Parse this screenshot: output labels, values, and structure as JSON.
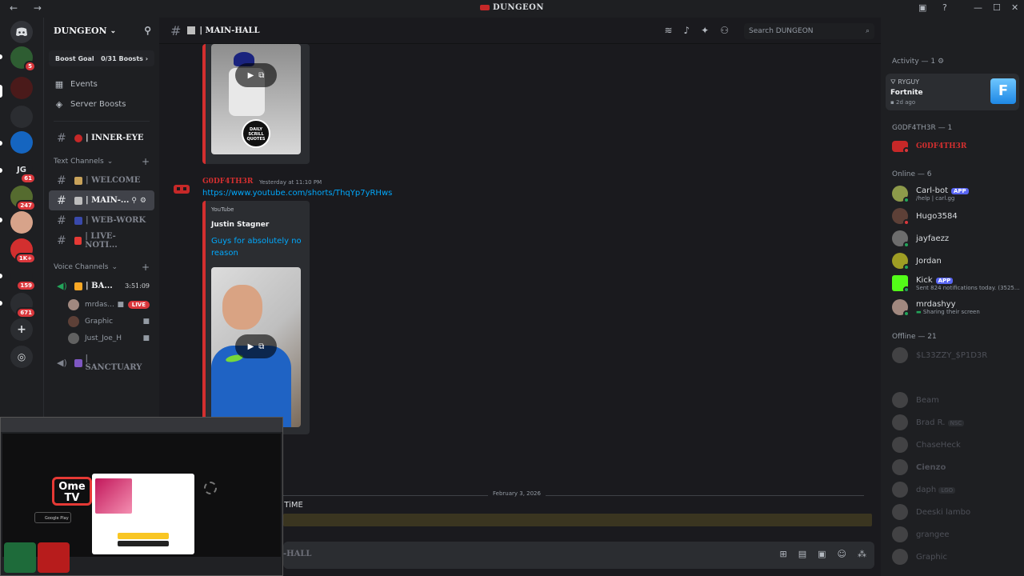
{
  "window": {
    "title": "DUNGEON"
  },
  "server": {
    "name": "DUNGEON",
    "boost_goal_label": "Boost Goal",
    "boost_count": "0/31 Boosts"
  },
  "guild_badges": [
    "5",
    "61",
    "247",
    "1K+",
    "159",
    "671"
  ],
  "guild_initials": "JG",
  "nav": {
    "events": "Events",
    "server_boosts": "Server Boosts"
  },
  "channels": {
    "top": "| INNER-EYE",
    "text_category": "Text Channels",
    "text": [
      {
        "name": "| WELCOME"
      },
      {
        "name": "| MAIN-..."
      },
      {
        "name": "| WEB-WORK"
      },
      {
        "name": "| LIVE-NOTI..."
      }
    ],
    "voice_category": "Voice Channels",
    "voice_channel": "| BA...",
    "voice_timer": "3:51:09",
    "voice_users": [
      {
        "name": "mrdas...",
        "live": "LIVE"
      },
      {
        "name": "Graphic"
      },
      {
        "name": "Just_Joe_H"
      }
    ],
    "sanctuary": "| SANCTUARY"
  },
  "header": {
    "channel_title": "| MAIN-HALL",
    "search_placeholder": "Search DUNGEON"
  },
  "messages": {
    "embed1_badge": [
      "DAILY",
      "SCRILL",
      "QUOTES"
    ],
    "author": "G0DF4TH3R",
    "timestamp": "Yesterday at 11:10 PM",
    "link": "https://www.youtube.com/shorts/ThqYp7yRHws",
    "embed_provider": "YouTube",
    "embed_author": "Justin Stagner",
    "embed_title": "Guys for absolutely no reason",
    "date_divider": "February 3, 2026",
    "partial_text": "T TiME",
    "composer_placeholder": "-HALL"
  },
  "members": {
    "activity_header": "Activity — 1",
    "activity": {
      "user": "RYGUY",
      "game": "Fortnite",
      "ago": "2d ago"
    },
    "role_header": "G0DF4TH3R — 1",
    "role_member": "G0DF4TH3R",
    "online_header": "Online — 6",
    "online": [
      {
        "name": "Carl-bot",
        "badge": "APP",
        "sub": "/help | carl.gg"
      },
      {
        "name": "Hugo3584"
      },
      {
        "name": "jayfaezz"
      },
      {
        "name": "Jordan"
      },
      {
        "name": "Kick",
        "badge": "APP",
        "sub": "Sent 824 notifications today. (3525..."
      },
      {
        "name": "mrdashyy",
        "sub": "Sharing their screen"
      }
    ],
    "offline_header": "Offline — 21",
    "offline": [
      {
        "name": "$L33ZZY_$P1D3R"
      },
      {
        "name": "Beam"
      },
      {
        "name": "Brad R.",
        "tag": "NSC"
      },
      {
        "name": "ChaseHeck"
      },
      {
        "name": "Cienzo"
      },
      {
        "name": "daph",
        "tag": "LGO"
      },
      {
        "name": "Deeski lambo"
      },
      {
        "name": "grangee"
      },
      {
        "name": "Graphic"
      }
    ]
  },
  "overlay": {
    "brand": "Ome TV",
    "store1": "Google Play"
  }
}
